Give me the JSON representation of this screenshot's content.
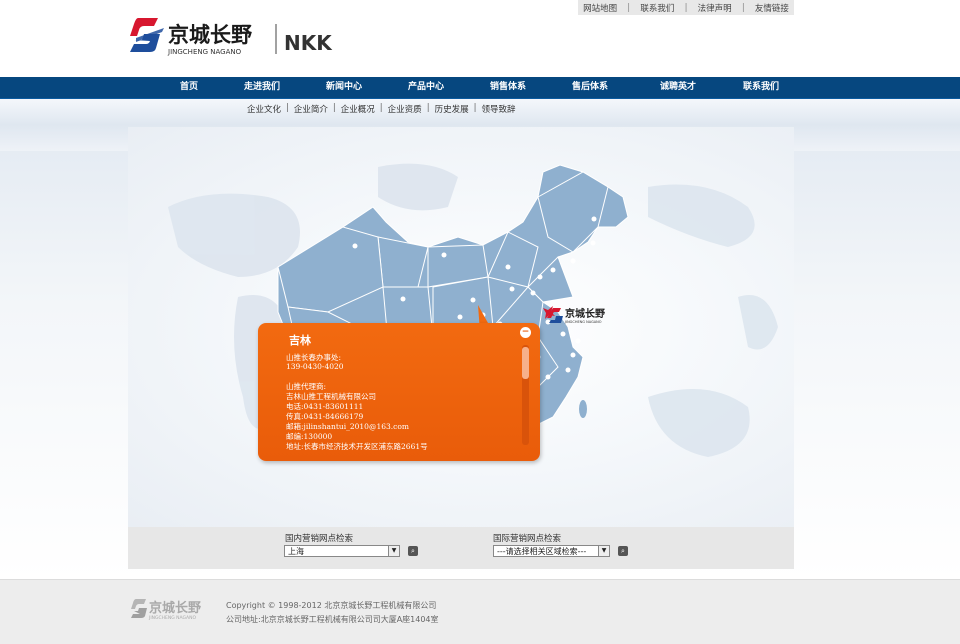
{
  "top_links": [
    "网站地图",
    "联系我们",
    "法律声明",
    "友情链接"
  ],
  "logo": {
    "cn": "京城长野",
    "en": "JINGCHENG NAGANO",
    "brand": "NKK"
  },
  "nav": [
    "首页",
    "走进我们",
    "新闻中心",
    "产品中心",
    "销售体系",
    "售后体系",
    "诚聘英才",
    "联系我们"
  ],
  "subnav": [
    "企业文化",
    "企业简介",
    "企业概况",
    "企业资质",
    "历史发展",
    "领导致辞"
  ],
  "map": {
    "marker_logo": "京城长野",
    "marker_sub": "JINGCHENG NAGANO"
  },
  "popup": {
    "title": "吉林",
    "lines": [
      "山推长春办事处:",
      "139-0430-4020",
      "",
      "山推代理商:",
      "吉林山推工程机械有限公司",
      "电话:0431-83601111",
      "传真:0431-84666179",
      "邮箱:jilinshantui_2010@163.com",
      "邮编:130000",
      "地址:长春市经济技术开发区浦东路2661号"
    ],
    "close_icon": "−"
  },
  "search": {
    "domestic_label": "国内营销网点检索",
    "domestic_value": "上海",
    "intl_label": "国际营销网点检索",
    "intl_value": "---请选择相关区域检索---"
  },
  "footer": {
    "logo_cn": "京城长野",
    "logo_en": "JINGCHENG NAGANO",
    "copyright": "Copyright © 1998-2012 北京京城长野工程机械有限公司",
    "address": "公司地址:北京京城长野工程机械有限公司司大厦A座1404室"
  },
  "colors": {
    "nav_bg": "#06477f",
    "popup_bg": "#f26a10",
    "map_fill": "#8fb0cf",
    "logo_red": "#d7172f",
    "logo_blue": "#1e4e9c"
  }
}
